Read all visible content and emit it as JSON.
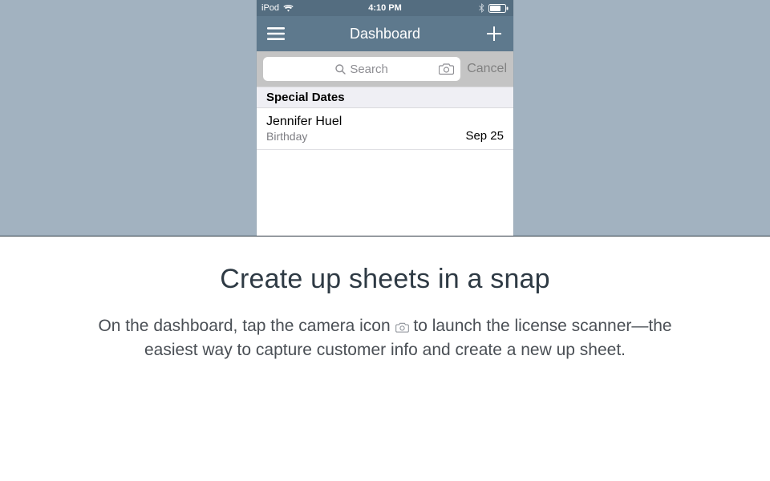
{
  "statusbar": {
    "device": "iPod",
    "time": "4:10 PM"
  },
  "navbar": {
    "title": "Dashboard"
  },
  "search": {
    "placeholder": "Search",
    "cancel_label": "Cancel"
  },
  "sections": [
    {
      "header": "Special Dates",
      "rows": [
        {
          "primary": "Jennifer Huel",
          "secondary": "Birthday",
          "right": "Sep 25"
        }
      ]
    }
  ],
  "marketing": {
    "headline": "Create up sheets in a snap",
    "body_prefix": "On the dashboard, tap the camera icon",
    "body_suffix": "to launch the license scanner—the easiest way to capture customer info and create a new up sheet."
  }
}
